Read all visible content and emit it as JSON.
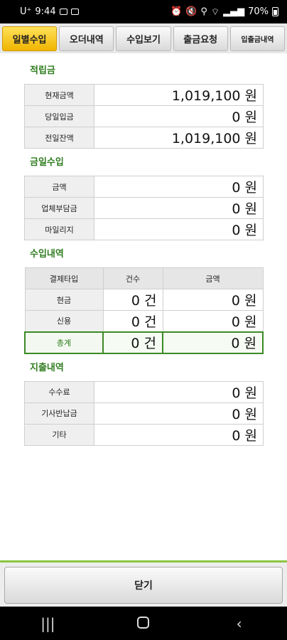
{
  "status_bar": {
    "carrier": "U⁺",
    "time": "9:44",
    "battery": "70%"
  },
  "tabs": [
    {
      "label": "일별수입",
      "active": true
    },
    {
      "label": "오더내역",
      "active": false
    },
    {
      "label": "수입보기",
      "active": false
    },
    {
      "label": "출금요청",
      "active": false
    },
    {
      "label": "입출금내역",
      "active": false
    }
  ],
  "savings": {
    "title": "적립금",
    "rows": [
      {
        "label": "현재금액",
        "value": "1,019,100",
        "unit": "원"
      },
      {
        "label": "당일입금",
        "value": "0",
        "unit": "원"
      },
      {
        "label": "전일잔액",
        "value": "1,019,100",
        "unit": "원"
      }
    ]
  },
  "today_income": {
    "title": "금일수입",
    "rows": [
      {
        "label": "금액",
        "value": "0",
        "unit": "원"
      },
      {
        "label": "업체부담금",
        "value": "0",
        "unit": "원"
      },
      {
        "label": "마일리지",
        "value": "0",
        "unit": "원"
      }
    ]
  },
  "income_detail": {
    "title": "수입내역",
    "headers": [
      "결제타입",
      "건수",
      "금액"
    ],
    "rows": [
      {
        "label": "현금",
        "count": "0",
        "count_unit": "건",
        "amount": "0",
        "amount_unit": "원"
      },
      {
        "label": "신용",
        "count": "0",
        "count_unit": "건",
        "amount": "0",
        "amount_unit": "원"
      },
      {
        "label": "총계",
        "count": "0",
        "count_unit": "건",
        "amount": "0",
        "amount_unit": "원"
      }
    ]
  },
  "expense_detail": {
    "title": "지출내역",
    "rows": [
      {
        "label": "수수료",
        "value": "0",
        "unit": "원"
      },
      {
        "label": "기사반납금",
        "value": "0",
        "unit": "원"
      },
      {
        "label": "기타",
        "value": "0",
        "unit": "원"
      }
    ]
  },
  "close_button": {
    "label": "닫기"
  },
  "colors": {
    "accent_green": "#2f7d1f",
    "active_tab": "#f5c518",
    "divider_green": "#8cc63f"
  }
}
